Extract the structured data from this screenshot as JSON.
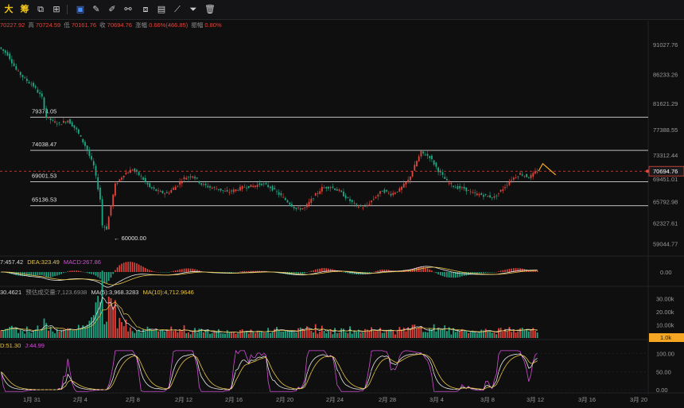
{
  "toolbar": {
    "items": [
      {
        "label": "大",
        "name": "timeframe-big-button"
      },
      {
        "label": "筹",
        "name": "chips-distribution-button"
      },
      {
        "label": "⧉",
        "name": "layout-icon"
      },
      {
        "label": "⊞",
        "name": "indicators-icon"
      },
      {
        "label": "▣",
        "name": "select-tool-icon"
      },
      {
        "label": "✎",
        "name": "draw-pen-icon"
      },
      {
        "label": "✐",
        "name": "brush-icon"
      },
      {
        "label": "⚯",
        "name": "magnet-icon"
      },
      {
        "label": "⧈",
        "name": "lock-drawing-icon"
      },
      {
        "label": "▤",
        "name": "note-icon"
      },
      {
        "label": "⟋",
        "name": "ruler-icon"
      },
      {
        "label": "⏷",
        "name": "filter-icon"
      },
      {
        "label": "🗑",
        "name": "trash-icon"
      }
    ]
  },
  "ohlc": {
    "open": "70227.92",
    "high_label": "高",
    "high": "70724.59",
    "low_label": "低",
    "low": "70161.76",
    "close_label": "收",
    "close": "70694.76",
    "change_label": "涨幅",
    "change": "0.66%(466.85)",
    "amplitude_label": "振幅",
    "amplitude": "0.80%"
  },
  "macd_header": {
    "dif": "7:457.42",
    "dea": "DEA:323.49",
    "macd": "MACD:267.86"
  },
  "volume_header": {
    "vol": "30.4621",
    "est": "预估成交量:7,123.6938",
    "ma5": "MA(5):3,968.3283",
    "ma10": "MA(10):4,712.9646"
  },
  "kdj_header": {
    "d": "D:51.30",
    "j": "J:44.99"
  },
  "colors": {
    "up": "#e0463d",
    "down": "#1fa884",
    "yellow": "#e8c547",
    "white": "#e8e8e8",
    "magenta": "#d24fd4",
    "orange": "#f5a623"
  },
  "chart_data": {
    "type": "candlestick",
    "title": "",
    "price_axis_ticks": [
      "91027.76",
      "86233.26",
      "81621.29",
      "77388.55",
      "73312.44",
      "69451.01",
      "65792.98",
      "62327.61",
      "59044.77"
    ],
    "price_range": [
      57300,
      93100
    ],
    "current_price": "70694.76",
    "levels": [
      {
        "label": "79374.05",
        "value": 79374.05
      },
      {
        "label": "74038.47",
        "value": 74038.47
      },
      {
        "label": "69001.53",
        "value": 69001.53
      },
      {
        "label": "65136.53",
        "value": 65136.53
      }
    ],
    "annotation_low": "← 60000.00",
    "x_ticks": [
      "1月 31",
      "2月 4",
      "2月 8",
      "2月 12",
      "2月 16",
      "2月 20",
      "2月 24",
      "2月 28",
      "3月 4",
      "3月 8",
      "3月 12",
      "3月 16",
      "3月 20"
    ],
    "price_path": [
      [
        0,
        90600
      ],
      [
        4,
        89500
      ],
      [
        8,
        87000
      ],
      [
        12,
        85500
      ],
      [
        16,
        84400
      ],
      [
        20,
        82500
      ],
      [
        22,
        79400
      ],
      [
        25,
        78700
      ],
      [
        28,
        78300
      ],
      [
        32,
        78900
      ],
      [
        36,
        77300
      ],
      [
        40,
        74800
      ],
      [
        44,
        71500
      ],
      [
        47,
        66200
      ],
      [
        48,
        62000
      ],
      [
        50,
        61500
      ],
      [
        52,
        65200
      ],
      [
        54,
        68500
      ],
      [
        58,
        70200
      ],
      [
        62,
        71000
      ],
      [
        66,
        69800
      ],
      [
        70,
        68100
      ],
      [
        74,
        67400
      ],
      [
        78,
        67100
      ],
      [
        82,
        68200
      ],
      [
        86,
        69600
      ],
      [
        90,
        70000
      ],
      [
        94,
        68600
      ],
      [
        98,
        68100
      ],
      [
        102,
        67800
      ],
      [
        106,
        67300
      ],
      [
        110,
        67700
      ],
      [
        114,
        68200
      ],
      [
        118,
        68300
      ],
      [
        122,
        68700
      ],
      [
        126,
        68100
      ],
      [
        130,
        67000
      ],
      [
        134,
        65800
      ],
      [
        138,
        64600
      ],
      [
        142,
        64800
      ],
      [
        146,
        66500
      ],
      [
        150,
        68000
      ],
      [
        154,
        68200
      ],
      [
        158,
        67500
      ],
      [
        162,
        66200
      ],
      [
        166,
        65100
      ],
      [
        170,
        64900
      ],
      [
        174,
        66300
      ],
      [
        178,
        67600
      ],
      [
        182,
        67000
      ],
      [
        186,
        67700
      ],
      [
        190,
        69200
      ],
      [
        194,
        72300
      ],
      [
        196,
        73700
      ],
      [
        200,
        73000
      ],
      [
        204,
        70800
      ],
      [
        208,
        69000
      ],
      [
        212,
        68100
      ],
      [
        216,
        67900
      ],
      [
        220,
        67100
      ],
      [
        224,
        66900
      ],
      [
        228,
        66600
      ],
      [
        230,
        66500
      ],
      [
        234,
        67900
      ],
      [
        238,
        69400
      ],
      [
        242,
        70300
      ],
      [
        246,
        69700
      ],
      [
        248,
        70200
      ],
      [
        250,
        70694.76
      ]
    ],
    "projection": [
      [
        250,
        70694.76
      ],
      [
        252,
        71900
      ],
      [
        258,
        70100
      ]
    ],
    "macd": {
      "axis_ticks": [
        "0.00"
      ]
    },
    "volume": {
      "axis_ticks": [
        "30.00k",
        "20.00k",
        "10.00k"
      ],
      "current_label": "1.0k"
    },
    "kdj": {
      "axis_ticks": [
        "100.00",
        "50.00",
        "0.00"
      ]
    }
  }
}
